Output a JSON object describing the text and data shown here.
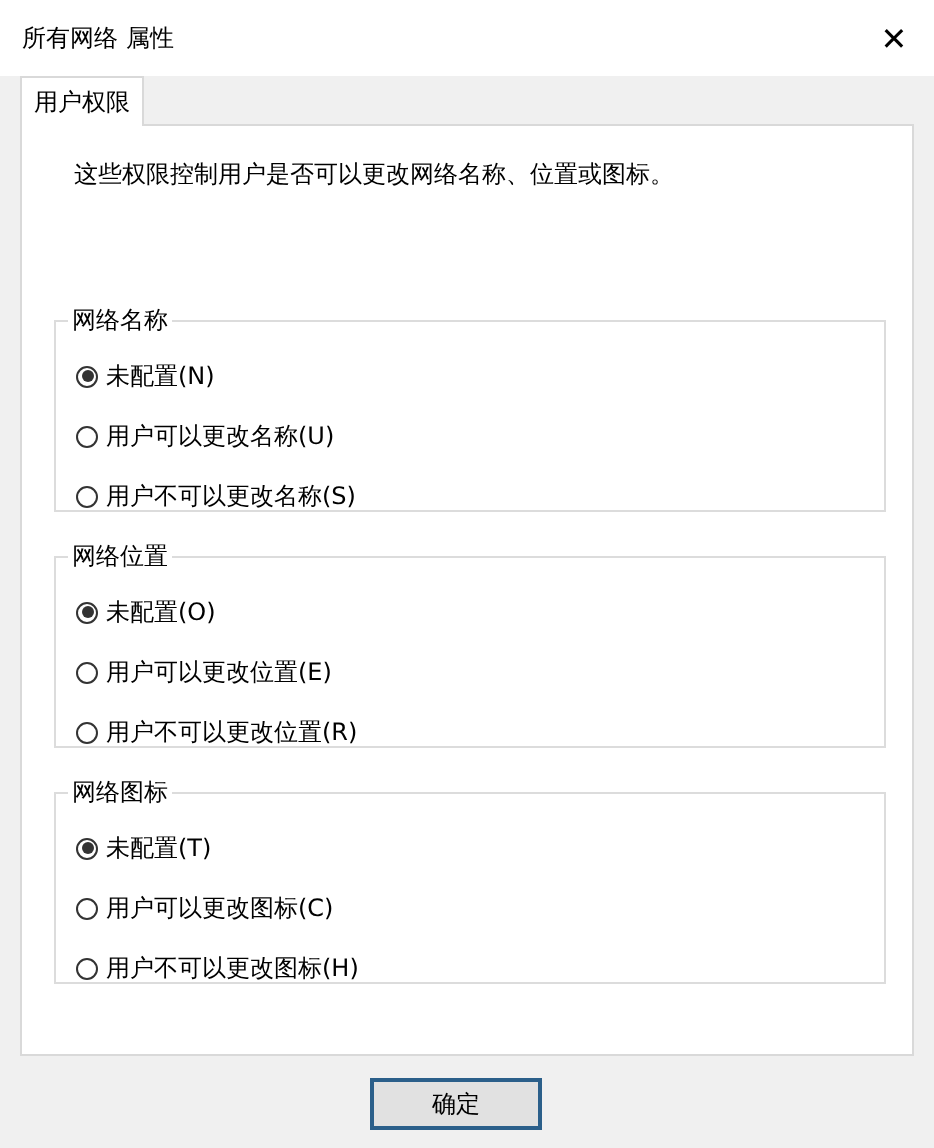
{
  "window": {
    "title": "所有网络 属性",
    "close": "✕"
  },
  "tabs": [
    {
      "label": "用户权限",
      "selected": true
    }
  ],
  "description": "这些权限控制用户是否可以更改网络名称、位置或图标。",
  "groups": [
    {
      "title": "网络名称",
      "options": [
        {
          "label": "未配置(N)",
          "selected": true
        },
        {
          "label": "用户可以更改名称(U)",
          "selected": false
        },
        {
          "label": "用户不可以更改名称(S)",
          "selected": false
        }
      ]
    },
    {
      "title": "网络位置",
      "options": [
        {
          "label": "未配置(O)",
          "selected": true
        },
        {
          "label": "用户可以更改位置(E)",
          "selected": false
        },
        {
          "label": "用户不可以更改位置(R)",
          "selected": false
        }
      ]
    },
    {
      "title": "网络图标",
      "options": [
        {
          "label": "未配置(T)",
          "selected": true
        },
        {
          "label": "用户可以更改图标(C)",
          "selected": false
        },
        {
          "label": "用户不可以更改图标(H)",
          "selected": false
        }
      ]
    }
  ],
  "buttons": [
    "确定"
  ]
}
